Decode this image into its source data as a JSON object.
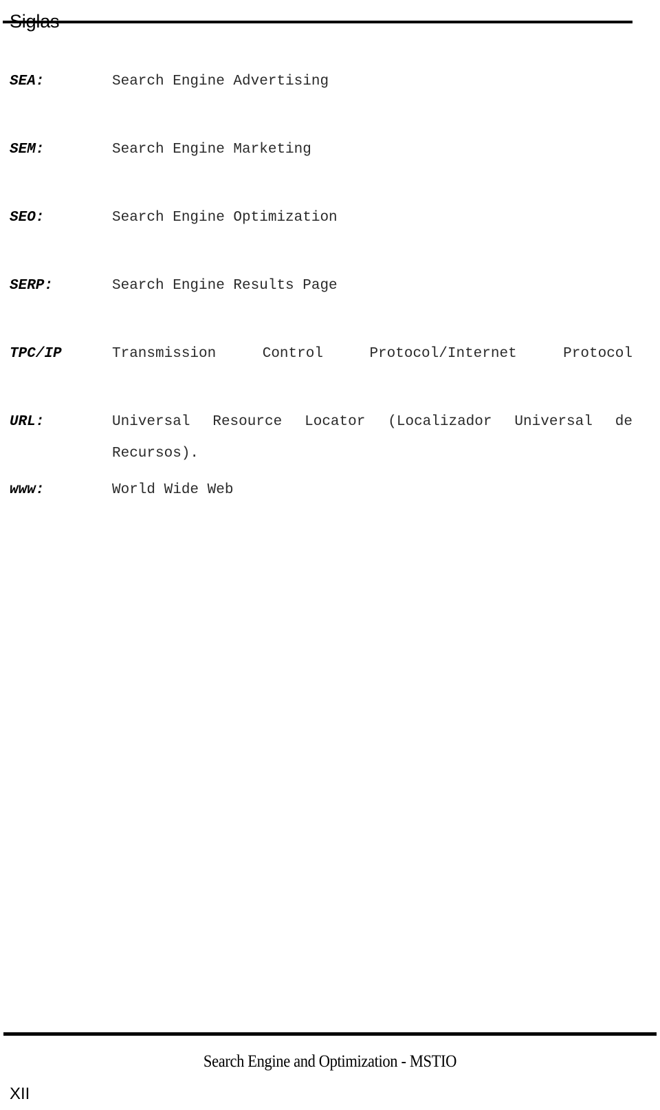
{
  "header": {
    "title": "Siglas"
  },
  "glossary": {
    "entries": [
      {
        "term": "SEA:",
        "definition": "Search Engine Advertising",
        "multiline": false
      },
      {
        "term": "SEM:",
        "definition": "Search Engine Marketing",
        "multiline": false
      },
      {
        "term": "SEO:",
        "definition": "Search Engine Optimization",
        "multiline": false
      },
      {
        "term": "SERP:",
        "definition": "Search Engine Results Page",
        "multiline": false
      },
      {
        "term": "TPC/IP",
        "definition": "Transmission Control Protocol/Internet Protocol",
        "multiline": true
      },
      {
        "term": "URL:",
        "definition": "Universal Resource Locator (Localizador Universal de Recursos).",
        "multiline": true
      },
      {
        "term": "www:",
        "definition": "World Wide Web",
        "multiline": false
      }
    ]
  },
  "footer": {
    "text": "Search Engine and Optimization - MSTIO",
    "page_number": "XII"
  }
}
